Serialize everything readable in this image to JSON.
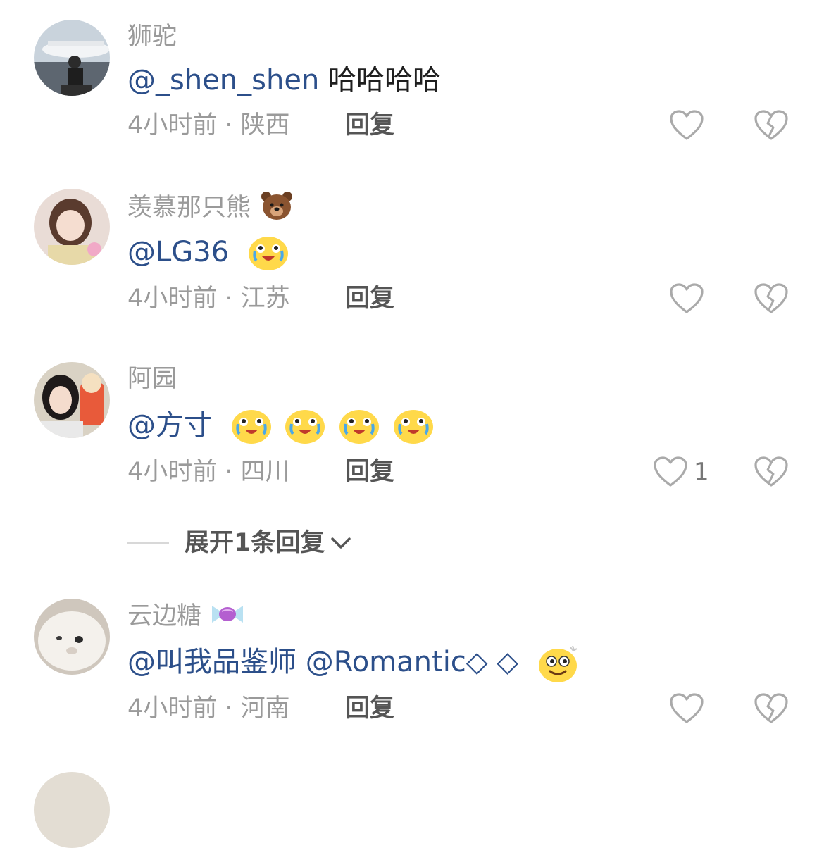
{
  "comments": [
    {
      "username": "狮驼",
      "body_mention": "@_shen_shen",
      "body_text": " 哈哈哈哈",
      "time_location": "4小时前 · 陕西",
      "reply_label": "回复"
    },
    {
      "username": "羡慕那只熊",
      "body_mention": "@LG36",
      "body_text": "",
      "time_location": "4小时前 · 江苏",
      "reply_label": "回复"
    },
    {
      "username": "阿园",
      "body_mention": "@方寸",
      "body_text": "",
      "time_location": "4小时前 · 四川",
      "reply_label": "回复",
      "like_count": "1"
    },
    {
      "username": "云边糖",
      "body_mention": "@叫我品鉴师 @Romantic◇ ◇",
      "body_text": "",
      "time_location": "4小时前 · 河南",
      "reply_label": "回复"
    }
  ],
  "expand_replies_label": "展开1条回复",
  "icons": {
    "like": "heart-outline-icon",
    "dislike": "broken-heart-icon",
    "expand": "chevron-down-icon"
  },
  "colors": {
    "mention": "#2c4f8a",
    "meta": "#9a9a9a",
    "action": "#555555"
  }
}
